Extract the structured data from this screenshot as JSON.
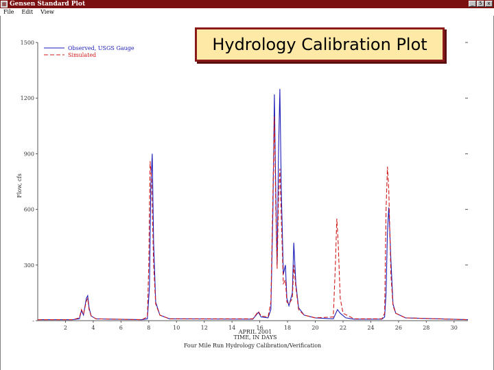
{
  "window": {
    "title": "Gensen Standard Plot",
    "icon": "plot-app-icon",
    "buttons": [
      "_",
      "5",
      "x"
    ]
  },
  "menu": {
    "items": [
      "File",
      "Edit",
      "View"
    ]
  },
  "banner": {
    "title": "Hydrology Calibration Plot"
  },
  "colors": {
    "observed": "#1a1ab8",
    "simulated": "#d01818",
    "titlebar": "#7a1010",
    "banner_bg": "#fee9a6",
    "banner_border": "#8b1a1a"
  },
  "chart_data": {
    "type": "line",
    "title": "",
    "ylabel": "Flow, cfs",
    "xlabel": "TIME, IN DAYS",
    "xlabel_month": "APRIL 2001",
    "caption": "Four Mile Run Hydrology Calibration/Verification",
    "ylim": [
      0,
      1500
    ],
    "xlim": [
      0,
      31
    ],
    "yticks": [
      {
        "v": 0,
        "label": "-"
      },
      {
        "v": 300,
        "label": "300"
      },
      {
        "v": 600,
        "label": "600"
      },
      {
        "v": 900,
        "label": "900"
      },
      {
        "v": 1200,
        "label": "1200"
      },
      {
        "v": 1500,
        "label": "1500"
      }
    ],
    "xticks": [
      {
        "v": 2,
        "label": "2"
      },
      {
        "v": 4,
        "label": "4"
      },
      {
        "v": 6,
        "label": "6"
      },
      {
        "v": 8,
        "label": "8"
      },
      {
        "v": 10,
        "label": "10"
      },
      {
        "v": 12,
        "label": "12"
      },
      {
        "v": 14,
        "label": "14"
      },
      {
        "v": 16,
        "label": "16"
      },
      {
        "v": 18,
        "label": "18"
      },
      {
        "v": 20,
        "label": "20"
      },
      {
        "v": 22,
        "label": "22"
      },
      {
        "v": 24,
        "label": "24"
      },
      {
        "v": 26,
        "label": "26"
      },
      {
        "v": 28,
        "label": "28"
      },
      {
        "v": 30,
        "label": "30"
      }
    ],
    "legend_position": "top-left",
    "series": [
      {
        "name": "Observed, USGS Gauge",
        "style": "solid",
        "points": [
          [
            0,
            5
          ],
          [
            2.5,
            5
          ],
          [
            3.0,
            10
          ],
          [
            3.15,
            55
          ],
          [
            3.3,
            30
          ],
          [
            3.5,
            120
          ],
          [
            3.6,
            135
          ],
          [
            3.7,
            70
          ],
          [
            3.85,
            25
          ],
          [
            4.2,
            10
          ],
          [
            7.5,
            5
          ],
          [
            7.9,
            10
          ],
          [
            8.05,
            180
          ],
          [
            8.15,
            720
          ],
          [
            8.25,
            900
          ],
          [
            8.35,
            420
          ],
          [
            8.5,
            100
          ],
          [
            8.8,
            30
          ],
          [
            9.5,
            10
          ],
          [
            15.5,
            8
          ],
          [
            15.9,
            45
          ],
          [
            16.1,
            20
          ],
          [
            16.6,
            15
          ],
          [
            16.8,
            60
          ],
          [
            16.95,
            600
          ],
          [
            17.05,
            1220
          ],
          [
            17.15,
            700
          ],
          [
            17.25,
            300
          ],
          [
            17.35,
            900
          ],
          [
            17.45,
            1250
          ],
          [
            17.55,
            700
          ],
          [
            17.7,
            250
          ],
          [
            17.85,
            300
          ],
          [
            17.95,
            120
          ],
          [
            18.1,
            80
          ],
          [
            18.35,
            150
          ],
          [
            18.45,
            420
          ],
          [
            18.6,
            200
          ],
          [
            18.8,
            70
          ],
          [
            19.2,
            30
          ],
          [
            20.0,
            15
          ],
          [
            21.3,
            10
          ],
          [
            21.6,
            60
          ],
          [
            21.8,
            40
          ],
          [
            22.2,
            15
          ],
          [
            22.8,
            8
          ],
          [
            24.8,
            8
          ],
          [
            25.0,
            20
          ],
          [
            25.1,
            150
          ],
          [
            25.2,
            480
          ],
          [
            25.3,
            610
          ],
          [
            25.45,
            330
          ],
          [
            25.6,
            90
          ],
          [
            25.8,
            40
          ],
          [
            26.5,
            15
          ],
          [
            31,
            5
          ]
        ]
      },
      {
        "name": "Simulated",
        "style": "dashed",
        "points": [
          [
            0,
            5
          ],
          [
            2.5,
            5
          ],
          [
            3.0,
            15
          ],
          [
            3.15,
            60
          ],
          [
            3.3,
            35
          ],
          [
            3.5,
            105
          ],
          [
            3.6,
            120
          ],
          [
            3.7,
            60
          ],
          [
            3.85,
            25
          ],
          [
            4.2,
            10
          ],
          [
            7.5,
            5
          ],
          [
            7.9,
            20
          ],
          [
            8.0,
            300
          ],
          [
            8.1,
            860
          ],
          [
            8.2,
            760
          ],
          [
            8.35,
            300
          ],
          [
            8.5,
            90
          ],
          [
            8.8,
            30
          ],
          [
            9.5,
            10
          ],
          [
            15.5,
            10
          ],
          [
            15.9,
            50
          ],
          [
            16.1,
            25
          ],
          [
            16.6,
            20
          ],
          [
            16.8,
            100
          ],
          [
            16.95,
            680
          ],
          [
            17.05,
            1100
          ],
          [
            17.15,
            620
          ],
          [
            17.25,
            280
          ],
          [
            17.35,
            650
          ],
          [
            17.45,
            820
          ],
          [
            17.55,
            550
          ],
          [
            17.7,
            200
          ],
          [
            17.85,
            220
          ],
          [
            17.95,
            100
          ],
          [
            18.1,
            90
          ],
          [
            18.35,
            120
          ],
          [
            18.45,
            300
          ],
          [
            18.6,
            180
          ],
          [
            18.8,
            60
          ],
          [
            19.2,
            30
          ],
          [
            20.0,
            15
          ],
          [
            21.3,
            20
          ],
          [
            21.45,
            300
          ],
          [
            21.55,
            550
          ],
          [
            21.65,
            420
          ],
          [
            21.8,
            120
          ],
          [
            22.0,
            40
          ],
          [
            22.8,
            10
          ],
          [
            24.8,
            10
          ],
          [
            25.0,
            40
          ],
          [
            25.1,
            600
          ],
          [
            25.2,
            830
          ],
          [
            25.3,
            700
          ],
          [
            25.45,
            250
          ],
          [
            25.6,
            80
          ],
          [
            25.8,
            40
          ],
          [
            26.5,
            15
          ],
          [
            31,
            5
          ]
        ]
      }
    ]
  }
}
